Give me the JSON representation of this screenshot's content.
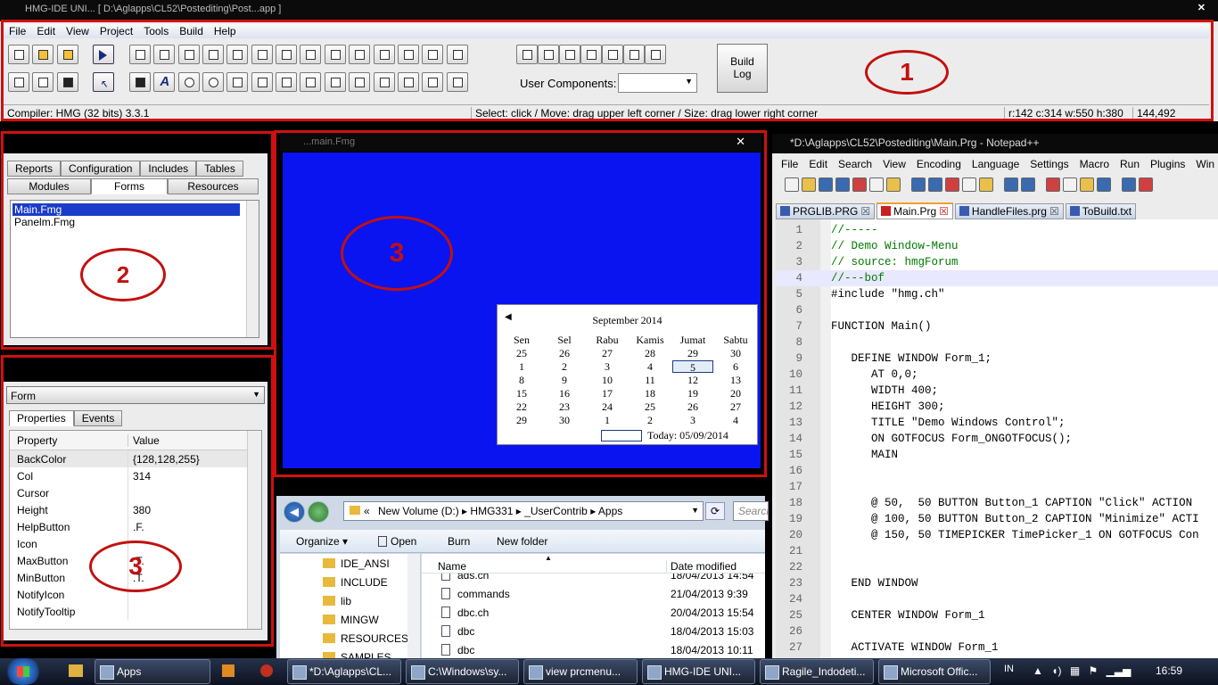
{
  "ide": {
    "title": "HMG-IDE  UNI...  [ D:\\Aglapps\\CL52\\Postediting\\Post...app ]",
    "menu": [
      "File",
      "Edit",
      "View",
      "Project",
      "Tools",
      "Build",
      "Help"
    ],
    "build_log": "Build\nLog",
    "user_components_label": "User Components:",
    "status": {
      "compiler": "Compiler: HMG (32 bits)  3.3.1",
      "hint": "Select: click / Move: drag upper left corner / Size: drag lower right corner",
      "geom": "r:142 c:314 w:550 h:380",
      "mouse": "144,492"
    }
  },
  "project": {
    "tabs_row1": [
      "Reports",
      "Configuration",
      "Includes",
      "Tables"
    ],
    "tabs_row2": [
      "Modules",
      "Forms",
      "Resources"
    ],
    "files": [
      "Main.Fmg",
      "Panelm.Fmg"
    ]
  },
  "props": {
    "object": "Form",
    "tabs": [
      "Properties",
      "Events"
    ],
    "headers": [
      "Property",
      "Value"
    ],
    "rows": [
      [
        "BackColor",
        "{128,128,255}"
      ],
      [
        "Col",
        "314"
      ],
      [
        "Cursor",
        ""
      ],
      [
        "Height",
        "380"
      ],
      [
        "HelpButton",
        ".F."
      ],
      [
        "Icon",
        ""
      ],
      [
        "MaxButton",
        ".T."
      ],
      [
        "MinButton",
        ".T."
      ],
      [
        "NotifyIcon",
        ""
      ],
      [
        "NotifyTooltip",
        ""
      ]
    ]
  },
  "form": {
    "title": "...main.Fmg",
    "calendar": {
      "month": "September 2014",
      "days": [
        "Sen",
        "Sel",
        "Rabu",
        "Kamis",
        "Jumat",
        "Sabtu"
      ],
      "weeks": [
        [
          "25",
          "26",
          "27",
          "28",
          "29",
          "30"
        ],
        [
          "1",
          "2",
          "3",
          "4",
          "5",
          "6"
        ],
        [
          "8",
          "9",
          "10",
          "11",
          "12",
          "13"
        ],
        [
          "15",
          "16",
          "17",
          "18",
          "19",
          "20"
        ],
        [
          "22",
          "23",
          "24",
          "25",
          "26",
          "27"
        ],
        [
          "29",
          "30",
          "1",
          "2",
          "3",
          "4"
        ]
      ],
      "today": "Today: 05/09/2014"
    }
  },
  "explorer": {
    "path": [
      "New Volume (D:)",
      "HMG331",
      "_UserContrib",
      "Apps"
    ],
    "search_placeholder": "Search",
    "toolbar": [
      "Organize",
      "Open",
      "Burn",
      "New folder"
    ],
    "tree": [
      "IDE_ANSI",
      "INCLUDE",
      "lib",
      "MINGW",
      "RESOURCES",
      "SAMPLES"
    ],
    "headers": [
      "Name",
      "Date modified"
    ],
    "files": [
      [
        "ads.ch",
        "18/04/2013 14:54"
      ],
      [
        "commands",
        "21/04/2013 9:39"
      ],
      [
        "dbc.ch",
        "20/04/2013 15:54"
      ],
      [
        "dbc",
        "18/04/2013 15:03"
      ],
      [
        "dbc",
        "18/04/2013 10:11"
      ]
    ]
  },
  "notepad": {
    "title": "*D:\\Aglapps\\CL52\\Postediting\\Main.Prg - Notepad++",
    "menu": [
      "File",
      "Edit",
      "Search",
      "View",
      "Encoding",
      "Language",
      "Settings",
      "Macro",
      "Run",
      "Plugins",
      "Win"
    ],
    "tabs": [
      "PRGLIB.PRG",
      "Main.Prg",
      "HandleFiles.prg",
      "ToBuild.txt"
    ],
    "lines": [
      {
        "n": "1",
        "t": "//-----",
        "c": "comment"
      },
      {
        "n": "2",
        "t": "// Demo Window-Menu",
        "c": "comment"
      },
      {
        "n": "3",
        "t": "// source: hmgForum",
        "c": "comment"
      },
      {
        "n": "4",
        "t": "//---bof",
        "c": "comment"
      },
      {
        "n": "5",
        "t": "#include \"hmg.ch\"",
        "c": "code"
      },
      {
        "n": "6",
        "t": "",
        "c": "code"
      },
      {
        "n": "7",
        "t": "FUNCTION Main()",
        "c": "code"
      },
      {
        "n": "8",
        "t": "",
        "c": "code"
      },
      {
        "n": "9",
        "t": "   DEFINE WINDOW Form_1;",
        "c": "code"
      },
      {
        "n": "10",
        "t": "      AT 0,0;",
        "c": "code"
      },
      {
        "n": "11",
        "t": "      WIDTH 400;",
        "c": "code"
      },
      {
        "n": "12",
        "t": "      HEIGHT 300;",
        "c": "code"
      },
      {
        "n": "13",
        "t": "      TITLE \"Demo Windows Control\";",
        "c": "code"
      },
      {
        "n": "14",
        "t": "      ON GOTFOCUS Form_ONGOTFOCUS();",
        "c": "code"
      },
      {
        "n": "15",
        "t": "      MAIN",
        "c": "code"
      },
      {
        "n": "16",
        "t": "",
        "c": "code"
      },
      {
        "n": "17",
        "t": "",
        "c": "code"
      },
      {
        "n": "18",
        "t": "      @ 50,  50 BUTTON Button_1 CAPTION \"Click\" ACTION",
        "c": "code"
      },
      {
        "n": "19",
        "t": "      @ 100, 50 BUTTON Button_2 CAPTION \"Minimize\" ACTI",
        "c": "code"
      },
      {
        "n": "20",
        "t": "      @ 150, 50 TIMEPICKER TimePicker_1 ON GOTFOCUS Con",
        "c": "code"
      },
      {
        "n": "21",
        "t": "",
        "c": "code"
      },
      {
        "n": "22",
        "t": "",
        "c": "code"
      },
      {
        "n": "23",
        "t": "   END WINDOW",
        "c": "code"
      },
      {
        "n": "24",
        "t": "",
        "c": "code"
      },
      {
        "n": "25",
        "t": "   CENTER WINDOW Form_1",
        "c": "code"
      },
      {
        "n": "26",
        "t": "",
        "c": "code"
      },
      {
        "n": "27",
        "t": "   ACTIVATE WINDOW Form_1",
        "c": "code"
      }
    ]
  },
  "annotations": [
    "1",
    "2",
    "3",
    "3"
  ],
  "taskbar": {
    "items": [
      "Apps",
      "*D:\\Aglapps\\CL...",
      "C:\\Windows\\sy...",
      "view prcmenu...",
      "HMG-IDE  UNI...",
      "Ragile_Indodeti...",
      "Microsoft Offic..."
    ],
    "lang": "IN",
    "clock": "16:59"
  },
  "colors": {
    "form_bg": "#0a14f0",
    "highlight": "#b40000",
    "annotation": "#c21010"
  }
}
